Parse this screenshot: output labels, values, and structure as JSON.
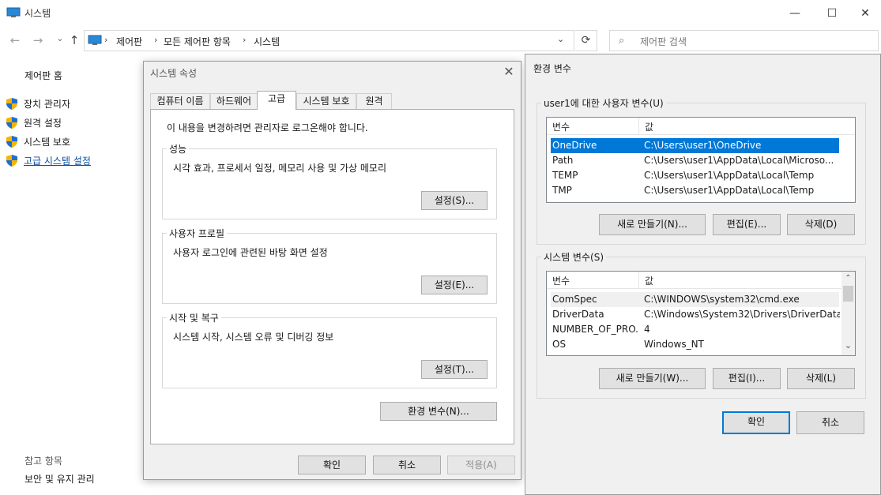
{
  "window": {
    "title": "시스템",
    "min_glyph": "—",
    "max_glyph": "☐",
    "close_glyph": "✕"
  },
  "nav": {
    "back_glyph": "←",
    "forward_glyph": "→",
    "up_glyph": "↑",
    "breadcrumbs": [
      "제어판",
      "모든 제어판 항목",
      "시스템"
    ],
    "sep_glyph": "›",
    "dropdown_glyph": "⌄",
    "refresh_glyph": "⟳",
    "search_placeholder": "제어판 검색"
  },
  "left_pane": {
    "home": "제어판 홈",
    "items": [
      {
        "label": "장치 관리자"
      },
      {
        "label": "원격 설정"
      },
      {
        "label": "시스템 보호"
      },
      {
        "label": "고급 시스템 설정"
      }
    ],
    "see_also": "참고 항목",
    "security": "보안 및 유지 관리"
  },
  "system_properties": {
    "title": "시스템 속성",
    "close_glyph": "✕",
    "tabs": [
      "컴퓨터 이름",
      "하드웨어",
      "고급",
      "시스템 보호",
      "원격"
    ],
    "active_tab": "고급",
    "notice": "이 내용을 변경하려면 관리자로 로그온해야 합니다.",
    "groups": [
      {
        "label": "성능",
        "desc": "시각 효과, 프로세서 일정, 메모리 사용 및 가상 메모리",
        "button": "설정(S)..."
      },
      {
        "label": "사용자 프로필",
        "desc": "사용자 로그인에 관련된 바탕 화면 설정",
        "button": "설정(E)..."
      },
      {
        "label": "시작 및 복구",
        "desc": "시스템 시작, 시스템 오류 및 디버깅 정보",
        "button": "설정(T)..."
      }
    ],
    "env_button": "환경 변수(N)...",
    "ok": "확인",
    "cancel": "취소",
    "apply": "적용(A)"
  },
  "env_vars": {
    "title": "환경 변수",
    "user_group": "user1에 대한 사용자 변수(U)",
    "col_var": "변수",
    "col_val": "값",
    "user_vars": [
      {
        "name": "OneDrive",
        "value": "C:\\Users\\user1\\OneDrive"
      },
      {
        "name": "Path",
        "value": "C:\\Users\\user1\\AppData\\Local\\Microso..."
      },
      {
        "name": "TEMP",
        "value": "C:\\Users\\user1\\AppData\\Local\\Temp"
      },
      {
        "name": "TMP",
        "value": "C:\\Users\\user1\\AppData\\Local\\Temp"
      }
    ],
    "user_new": "새로 만들기(N)...",
    "user_edit": "편집(E)...",
    "user_delete": "삭제(D)",
    "system_group": "시스템 변수(S)",
    "system_vars": [
      {
        "name": "ComSpec",
        "value": "C:\\WINDOWS\\system32\\cmd.exe"
      },
      {
        "name": "DriverData",
        "value": "C:\\Windows\\System32\\Drivers\\DriverData"
      },
      {
        "name": "NUMBER_OF_PRO...",
        "value": "4"
      },
      {
        "name": "OS",
        "value": "Windows_NT"
      }
    ],
    "sys_new": "새로 만들기(W)...",
    "sys_edit": "편집(I)...",
    "sys_delete": "삭제(L)",
    "ok": "확인",
    "cancel": "취소",
    "scroll_up_glyph": "⌃",
    "scroll_down_glyph": "⌄"
  },
  "colors": {
    "selection": "#0078d7",
    "link": "#0a4ea1",
    "dialog_bg": "#f0f0f0"
  }
}
